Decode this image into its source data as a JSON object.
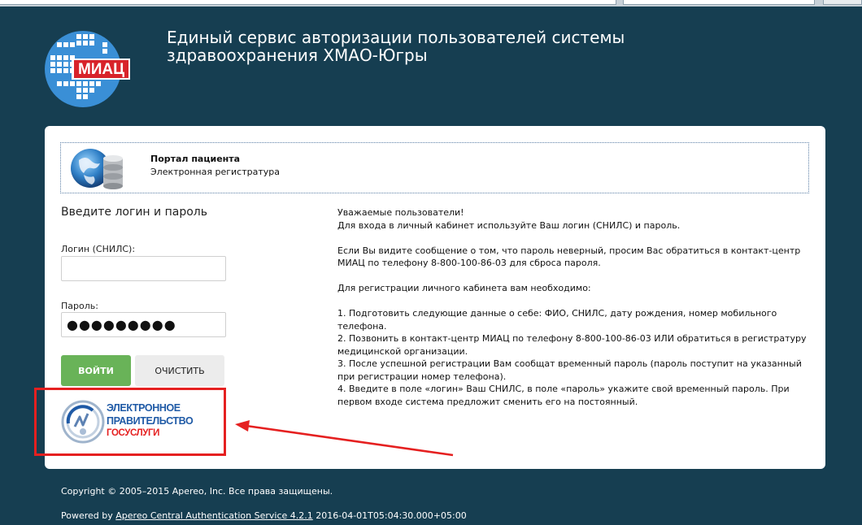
{
  "header": {
    "title_line1": "Единый сервис авторизации пользователей системы",
    "title_line2": "здравоохранения ХМАО-Югры",
    "logo_text": "МИАЦ"
  },
  "portal": {
    "title": "Портал пациента",
    "subtitle": "Электронная регистратура"
  },
  "login_form": {
    "heading": "Введите логин и пароль",
    "login_label": "Логин (СНИЛС):",
    "login_value": "",
    "password_label": "Пароль:",
    "password_value": "●●●●●●●●●",
    "login_button": "ВОЙТИ",
    "clear_button": "ОЧИСТИТЬ"
  },
  "info": {
    "greeting": "Уважаемые пользователи!",
    "line1": "Для входа в личный кабинет используйте Ваш логин (СНИЛС) и пароль.",
    "line2": "Если Вы видите сообщение о том, что пароль неверный, просим Вас обратиться в контакт-центр МИАЦ по телефону 8-800-100-86-03 для сброса пароля.",
    "line3": "Для регистрации личного кабинета вам необходимо:",
    "step1": "1. Подготовить следующие данные о себе: ФИО, СНИЛС, дату рождения, номер мобильного телефона.",
    "step2": "2. Позвонить в контакт-центр МИАЦ по телефону 8-800-100-86-03 ИЛИ обратиться в регистратуру медицинской организации.",
    "step3": "3. После успешной регистрации Вам сообщат временный пароль (пароль поступит на указанный при регистрации номер телефона).",
    "step4": "4. Введите в поле «логин» Ваш СНИЛС, в поле «пароль» укажите свой временный пароль. При первом входе система предложит сменить его на постоянный."
  },
  "gosuslugi": {
    "line1": "ЭЛЕКТРОННОЕ",
    "line2": "ПРАВИТЕЛЬСТВО",
    "line3": "ГОСУСЛУГИ"
  },
  "footer": {
    "copyright": "Copyright © 2005–2015 Apereo, Inc. Все права защищены.",
    "powered_prefix": "Powered by ",
    "powered_link": "Apereo Central Authentication Service 4.2.1",
    "powered_suffix": " 2016-04-01T05:04:30.000+05:00"
  },
  "colors": {
    "background": "#163e51",
    "login_button": "#69b358",
    "highlight": "#e52020"
  }
}
